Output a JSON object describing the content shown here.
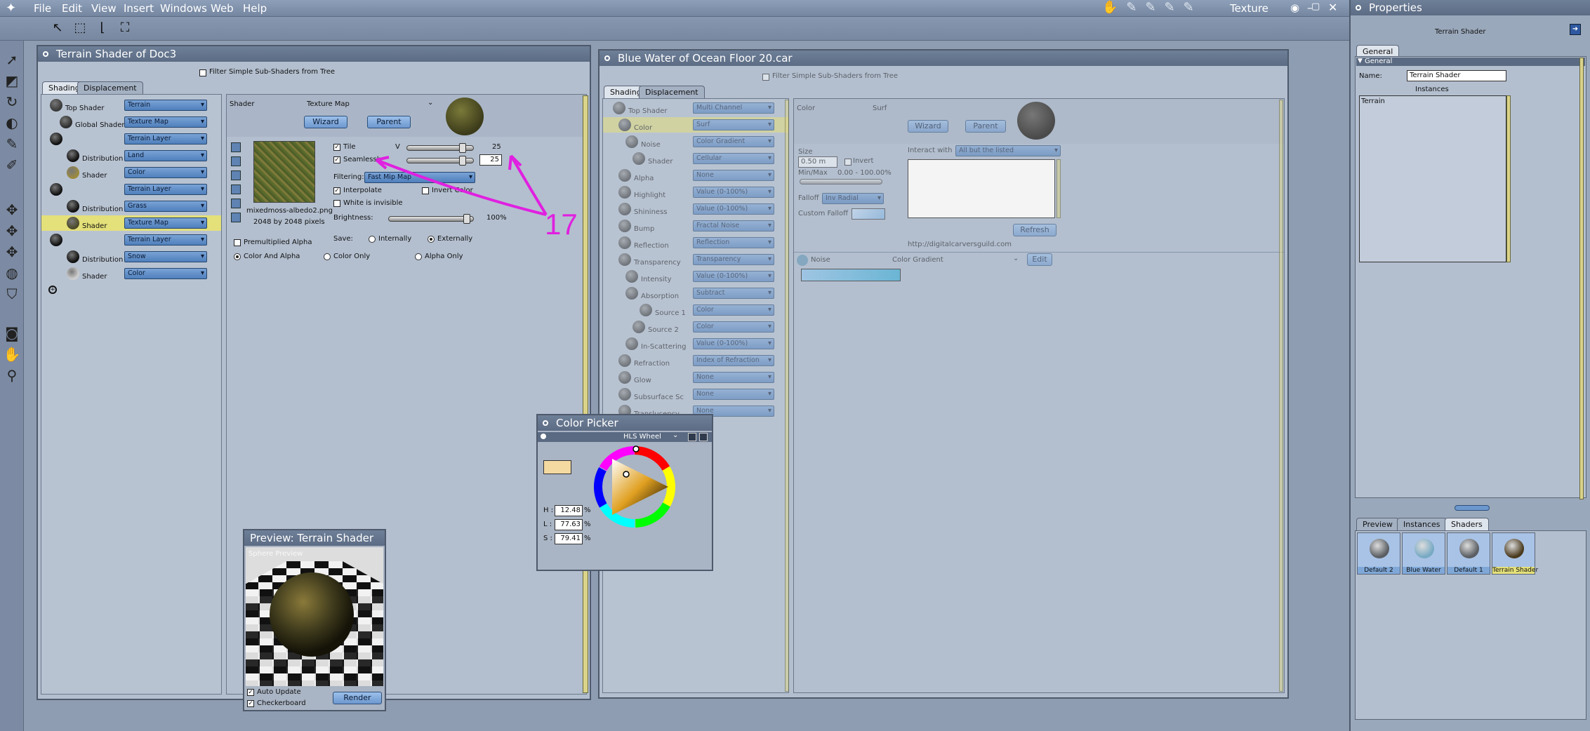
{
  "menubar": {
    "items": [
      "File",
      "Edit",
      "View",
      "Insert",
      "Windows",
      "Web",
      "Help"
    ],
    "room": "Texture"
  },
  "props": {
    "title": "Properties",
    "shader_name": "Terrain Shader",
    "tab_general": "General",
    "section_general": "General",
    "name_label": "Name:",
    "name_value": "Terrain Shader",
    "instances_label": "Instances",
    "instances_list": [
      "Terrain"
    ],
    "bottom_tabs": [
      "Preview",
      "Instances",
      "Shaders"
    ],
    "shaders": [
      {
        "name": "Default 2",
        "color": "#5a5e62"
      },
      {
        "name": "Blue Water",
        "color": "#78aac4"
      },
      {
        "name": "Default 1",
        "color": "#5a5e62"
      },
      {
        "name": "Terrain Shader",
        "color": "#4a3a1e"
      }
    ]
  },
  "terrain": {
    "title": "Terrain Shader of Doc3",
    "filter_label": "Filter Simple Sub-Shaders from Tree",
    "tabs": [
      "Shading",
      "Displacement"
    ],
    "tree": [
      {
        "label": "Top Shader",
        "dd": "Terrain",
        "ball": "#3a3a3a"
      },
      {
        "label": "Global Shader",
        "dd": "Texture Map",
        "ball": "#2e2e2e"
      },
      {
        "label": "",
        "dd": "Terrain Layer",
        "ball": "#111"
      },
      {
        "label": "Distribution",
        "dd": "Land",
        "ball": "#111"
      },
      {
        "label": "Shader",
        "dd": "Color",
        "ball": "#9c8a3e"
      },
      {
        "label": "",
        "dd": "Terrain Layer",
        "ball": "#111"
      },
      {
        "label": "Distribution",
        "dd": "Grass",
        "ball": "#111"
      },
      {
        "label": "Shader",
        "dd": "Texture Map",
        "ball": "#4b4a28"
      },
      {
        "label": "",
        "dd": "Terrain Layer",
        "ball": "#111"
      },
      {
        "label": "Distribution",
        "dd": "Snow",
        "ball": "#111"
      },
      {
        "label": "Shader",
        "dd": "Color",
        "ball": "#cfcfcf"
      }
    ],
    "editor": {
      "shader_label": "Shader",
      "type": "Texture Map",
      "wizard": "Wizard",
      "parent": "Parent",
      "tile": "Tile",
      "v_label": "V",
      "tile_value": "25",
      "seamlessly": "Seamlessly",
      "seam_value": "25",
      "filename": "mixedmoss-albedo2.png",
      "size": "2048 by 2048 pixels",
      "filtering_label": "Filtering:",
      "filtering_value": "Fast Mip Map",
      "interpolate": "Interpolate",
      "invert_color": "Invert Color",
      "white_invisible": "White is invisible",
      "brightness_label": "Brightness:",
      "brightness_value": "100%",
      "premult": "Premultiplied Alpha",
      "save_label": "Save:",
      "internally": "Internally",
      "externally": "Externally",
      "color_alpha": "Color And Alpha",
      "color_only": "Color Only",
      "alpha_only": "Alpha Only"
    }
  },
  "annotation": {
    "text": "17",
    "color": "#e020e0"
  },
  "water": {
    "title": "Blue Water of Ocean Floor 20.car",
    "filter_label": "Filter Simple Sub-Shaders from Tree",
    "tabs": [
      "Shading",
      "Displacement"
    ],
    "tree": [
      {
        "label": "Top Shader",
        "dd": "Multi Channel"
      },
      {
        "label": "Color",
        "dd": "Surf"
      },
      {
        "label": "Noise",
        "dd": "Color Gradient"
      },
      {
        "label": "Shader",
        "dd": "Cellular"
      },
      {
        "label": "Alpha",
        "dd": "None"
      },
      {
        "label": "Highlight",
        "dd": "Value (0-100%)"
      },
      {
        "label": "Shininess",
        "dd": "Value (0-100%)"
      },
      {
        "label": "Bump",
        "dd": "Fractal Noise"
      },
      {
        "label": "Reflection",
        "dd": "Reflection"
      },
      {
        "label": "Transparency",
        "dd": "Transparency"
      },
      {
        "label": "Intensity",
        "dd": "Value (0-100%)"
      },
      {
        "label": "Absorption",
        "dd": "Subtract"
      },
      {
        "label": "Source 1",
        "dd": "Color"
      },
      {
        "label": "Source 2",
        "dd": "Color"
      },
      {
        "label": "In-Scattering",
        "dd": "Value (0-100%)"
      },
      {
        "label": "Refraction",
        "dd": "Index of Refraction"
      },
      {
        "label": "Glow",
        "dd": "None"
      },
      {
        "label": "Subsurface Sc",
        "dd": "None"
      },
      {
        "label": "Translucency",
        "dd": "None"
      }
    ],
    "editor": {
      "label": "Color",
      "type": "Surf",
      "wizard": "Wizard",
      "parent": "Parent",
      "size_label": "Size",
      "size_value": "0.50 m",
      "invert": "Invert",
      "minmax_label": "Min/Max",
      "minmax_value": "0.00 - 100.00%",
      "interact_label": "Interact with",
      "interact_value": "All but the listed",
      "falloff_label": "Falloff",
      "falloff_value": "Inv Radial",
      "custom_falloff": "Custom Falloff",
      "refresh": "Refresh",
      "url": "http://digitalcarversguild.com",
      "noise_label": "Noise",
      "noise_type": "Color Gradient",
      "edit": "Edit"
    }
  },
  "picker": {
    "title": "Color Picker",
    "mode": "HLS Wheel",
    "h_label": "H :",
    "h_value": "12.48",
    "l_label": "L :",
    "l_value": "77.63",
    "s_label": "S :",
    "s_value": "79.41",
    "unit": "%",
    "swatch": "#f4d9a0"
  },
  "preview": {
    "title": "Preview: Terrain Shader",
    "sphere_label": "Sphere Preview",
    "auto_update": "Auto Update",
    "checkerboard": "Checkerboard",
    "render": "Render"
  }
}
